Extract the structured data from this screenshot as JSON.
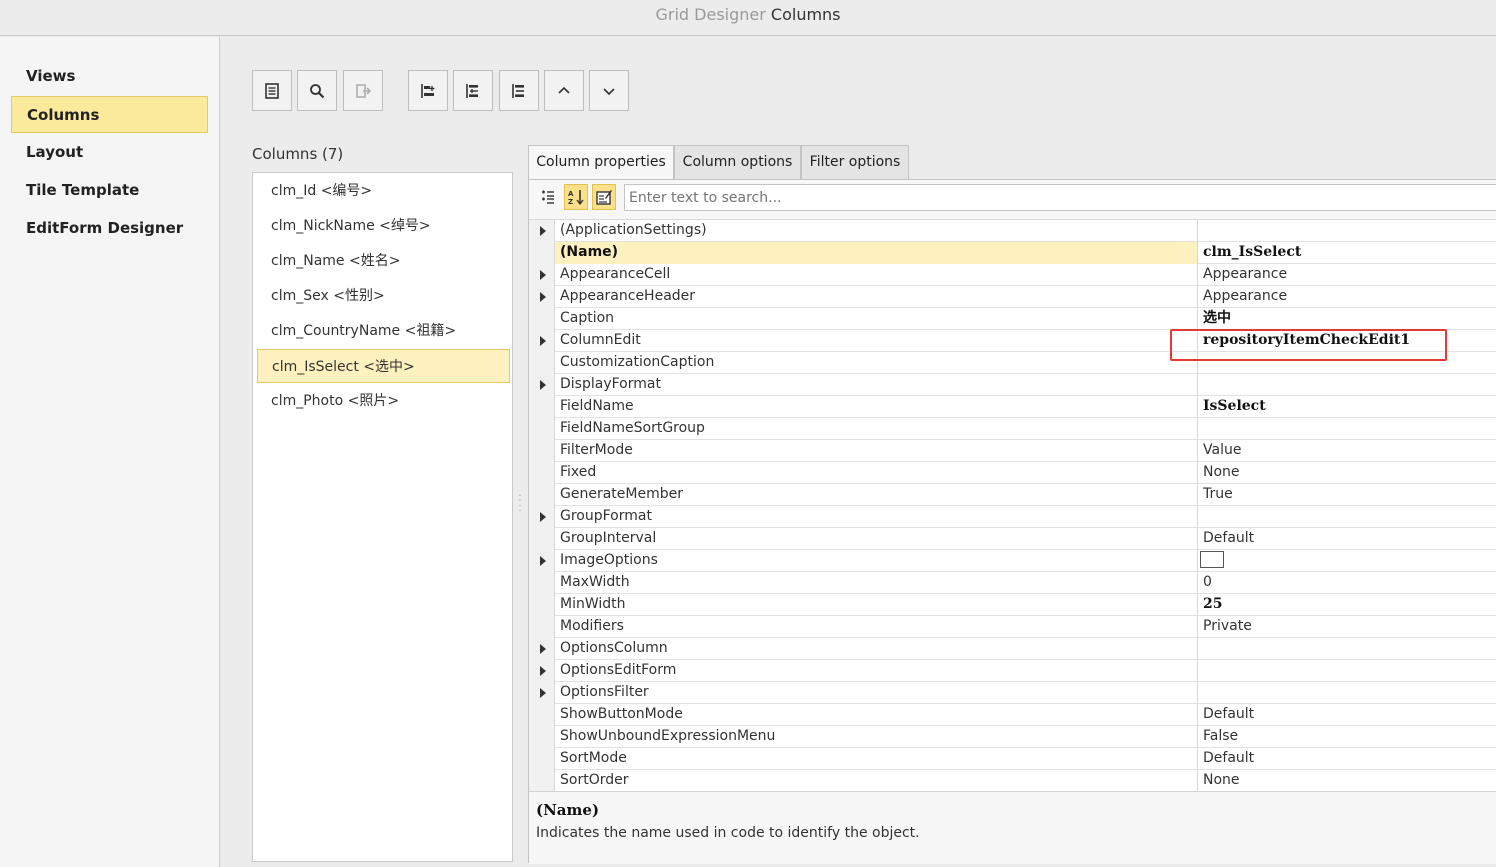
{
  "window": {
    "title_prefix": "Grid Designer",
    "title_section": "Columns"
  },
  "nav": {
    "items": [
      {
        "label": "Views"
      },
      {
        "label": "Columns",
        "active": true
      },
      {
        "label": "Layout"
      },
      {
        "label": "Tile Template"
      },
      {
        "label": "EditForm Designer"
      }
    ]
  },
  "toolbar": {
    "buttons": [
      {
        "icon": "show-feature-browser-icon"
      },
      {
        "icon": "search-icon"
      },
      {
        "icon": "retrieve-fields-icon",
        "disabled": true
      },
      {
        "icon": "add-column-icon"
      },
      {
        "icon": "insert-column-icon"
      },
      {
        "icon": "remove-column-icon"
      },
      {
        "icon": "move-up-icon"
      },
      {
        "icon": "move-down-icon"
      }
    ]
  },
  "columns": {
    "header": "Columns (7)",
    "items": [
      "clm_Id <编号>",
      "clm_NickName <绰号>",
      "clm_Name <姓名>",
      "clm_Sex <性别>",
      "clm_CountryName <祖籍>",
      "clm_IsSelect <选中>",
      "clm_Photo <照片>"
    ],
    "selected_index": 5
  },
  "tabs": [
    {
      "label": "Column properties",
      "active": true
    },
    {
      "label": "Column options"
    },
    {
      "label": "Filter options"
    }
  ],
  "property_grid": {
    "search_placeholder": "Enter text to search...",
    "rows": [
      {
        "name": "(ApplicationSettings)",
        "value": "",
        "expandable": true
      },
      {
        "name": "(Name)",
        "value": "clm_IsSelect",
        "bold": true,
        "selected": true
      },
      {
        "name": "AppearanceCell",
        "value": "Appearance",
        "expandable": true
      },
      {
        "name": "AppearanceHeader",
        "value": "Appearance",
        "expandable": true
      },
      {
        "name": "Caption",
        "value": "选中",
        "bold": true
      },
      {
        "name": "ColumnEdit",
        "value": "repositoryItemCheckEdit1",
        "bold": true,
        "expandable": true
      },
      {
        "name": "CustomizationCaption",
        "value": ""
      },
      {
        "name": "DisplayFormat",
        "value": "",
        "expandable": true
      },
      {
        "name": "FieldName",
        "value": "IsSelect",
        "bold": true
      },
      {
        "name": "FieldNameSortGroup",
        "value": ""
      },
      {
        "name": "FilterMode",
        "value": "Value"
      },
      {
        "name": "Fixed",
        "value": "None"
      },
      {
        "name": "GenerateMember",
        "value": "True"
      },
      {
        "name": "GroupFormat",
        "value": "",
        "expandable": true
      },
      {
        "name": "GroupInterval",
        "value": "Default"
      },
      {
        "name": "ImageOptions",
        "value": "",
        "expandable": true,
        "color_box": true
      },
      {
        "name": "MaxWidth",
        "value": "0"
      },
      {
        "name": "MinWidth",
        "value": "25",
        "bold": true
      },
      {
        "name": "Modifiers",
        "value": "Private"
      },
      {
        "name": "OptionsColumn",
        "value": "",
        "expandable": true
      },
      {
        "name": "OptionsEditForm",
        "value": "",
        "expandable": true
      },
      {
        "name": "OptionsFilter",
        "value": "",
        "expandable": true
      },
      {
        "name": "ShowButtonMode",
        "value": "Default"
      },
      {
        "name": "ShowUnboundExpressionMenu",
        "value": "False"
      },
      {
        "name": "SortMode",
        "value": "Default"
      },
      {
        "name": "SortOrder",
        "value": "None"
      }
    ],
    "description": {
      "title": "(Name)",
      "text": "Indicates the name used in code to identify the object."
    }
  }
}
